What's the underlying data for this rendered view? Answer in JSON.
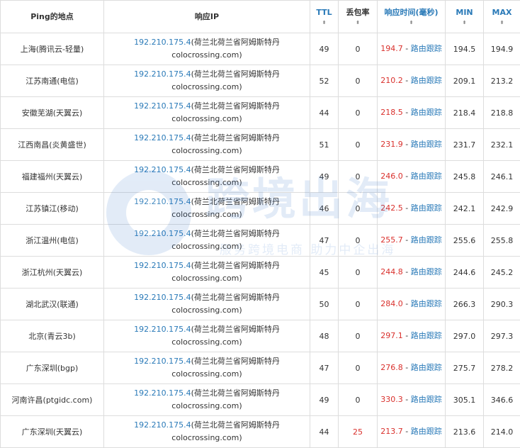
{
  "headers": {
    "location": "Ping的地点",
    "ip": "响应IP",
    "ttl": "TTL",
    "loss": "丢包率",
    "resp": "响应时间(毫秒)",
    "min": "MIN",
    "max": "MAX",
    "sort_icon": "⬍"
  },
  "trace_label": "路由跟踪",
  "watermark": {
    "title": "跨境出海",
    "subtitle": "服务跨境电商 助力中企出海"
  },
  "rows": [
    {
      "location": "上海(腾讯云-轻量)",
      "ip": "192.210.175.4",
      "geo": "(荷兰北荷兰省阿姆斯特丹",
      "host": "colocrossing.com)",
      "ttl": "49",
      "loss": "0",
      "resp": "194.7",
      "min": "194.5",
      "max": "194.9"
    },
    {
      "location": "江苏南通(电信)",
      "ip": "192.210.175.4",
      "geo": "(荷兰北荷兰省阿姆斯特丹",
      "host": "colocrossing.com)",
      "ttl": "52",
      "loss": "0",
      "resp": "210.2",
      "min": "209.1",
      "max": "213.2"
    },
    {
      "location": "安徽芜湖(天翼云)",
      "ip": "192.210.175.4",
      "geo": "(荷兰北荷兰省阿姆斯特丹",
      "host": "colocrossing.com)",
      "ttl": "44",
      "loss": "0",
      "resp": "218.5",
      "min": "218.4",
      "max": "218.8"
    },
    {
      "location": "江西南昌(炎黄盛世)",
      "ip": "192.210.175.4",
      "geo": "(荷兰北荷兰省阿姆斯特丹",
      "host": "colocrossing.com)",
      "ttl": "51",
      "loss": "0",
      "resp": "231.9",
      "min": "231.7",
      "max": "232.1"
    },
    {
      "location": "福建福州(天翼云)",
      "ip": "192.210.175.4",
      "geo": "(荷兰北荷兰省阿姆斯特丹",
      "host": "colocrossing.com)",
      "ttl": "49",
      "loss": "0",
      "resp": "246.0",
      "min": "245.8",
      "max": "246.1"
    },
    {
      "location": "江苏镇江(移动)",
      "ip": "192.210.175.4",
      "geo": "(荷兰北荷兰省阿姆斯特丹",
      "host": "colocrossing.com)",
      "ttl": "46",
      "loss": "0",
      "resp": "242.5",
      "min": "242.1",
      "max": "242.9"
    },
    {
      "location": "浙江温州(电信)",
      "ip": "192.210.175.4",
      "geo": "(荷兰北荷兰省阿姆斯特丹",
      "host": "colocrossing.com)",
      "ttl": "47",
      "loss": "0",
      "resp": "255.7",
      "min": "255.6",
      "max": "255.8"
    },
    {
      "location": "浙江杭州(天翼云)",
      "ip": "192.210.175.4",
      "geo": "(荷兰北荷兰省阿姆斯特丹",
      "host": "colocrossing.com)",
      "ttl": "45",
      "loss": "0",
      "resp": "244.8",
      "min": "244.6",
      "max": "245.2"
    },
    {
      "location": "湖北武汉(联通)",
      "ip": "192.210.175.4",
      "geo": "(荷兰北荷兰省阿姆斯特丹",
      "host": "colocrossing.com)",
      "ttl": "50",
      "loss": "0",
      "resp": "284.0",
      "min": "266.3",
      "max": "290.3"
    },
    {
      "location": "北京(青云3b)",
      "ip": "192.210.175.4",
      "geo": "(荷兰北荷兰省阿姆斯特丹",
      "host": "colocrossing.com)",
      "ttl": "48",
      "loss": "0",
      "resp": "297.1",
      "min": "297.0",
      "max": "297.3"
    },
    {
      "location": "广东深圳(bgp)",
      "ip": "192.210.175.4",
      "geo": "(荷兰北荷兰省阿姆斯特丹",
      "host": "colocrossing.com)",
      "ttl": "47",
      "loss": "0",
      "resp": "276.8",
      "min": "275.7",
      "max": "278.2"
    },
    {
      "location": "河南许昌(ptgidc.com)",
      "ip": "192.210.175.4",
      "geo": "(荷兰北荷兰省阿姆斯特丹",
      "host": "colocrossing.com)",
      "ttl": "49",
      "loss": "0",
      "resp": "330.3",
      "min": "305.1",
      "max": "346.6"
    },
    {
      "location": "广东深圳(天翼云)",
      "ip": "192.210.175.4",
      "geo": "(荷兰北荷兰省阿姆斯特丹",
      "host": "colocrossing.com)",
      "ttl": "44",
      "loss": "25",
      "resp": "213.7",
      "min": "213.6",
      "max": "214.0"
    }
  ],
  "colors": {
    "link": "#2a7ab8",
    "alert": "#d9302c",
    "border": "#dddddd",
    "watermark": "#2a6fc9"
  }
}
